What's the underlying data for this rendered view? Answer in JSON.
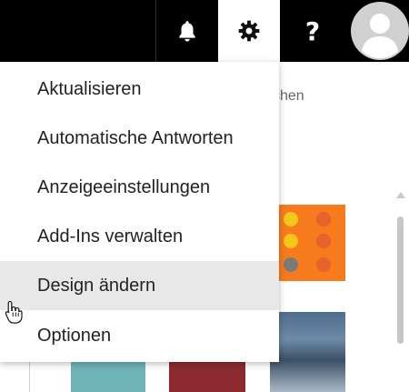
{
  "topbar": {
    "icons": [
      "bell-icon",
      "gear-icon",
      "help-icon",
      "user-avatar"
    ],
    "help_label": "?"
  },
  "background": {
    "partial_text": "chen"
  },
  "menu": {
    "items": [
      {
        "label": "Aktualisieren"
      },
      {
        "label": "Automatische Antworten"
      },
      {
        "label": "Anzeigeeinstellungen"
      },
      {
        "label": "Add-Ins verwalten"
      },
      {
        "label": "Design ändern",
        "hovered": true
      },
      {
        "label": "Optionen"
      }
    ]
  },
  "colors": {
    "topbar": "#000000",
    "menu_hover": "#e8e8e8",
    "text": "#222222"
  }
}
